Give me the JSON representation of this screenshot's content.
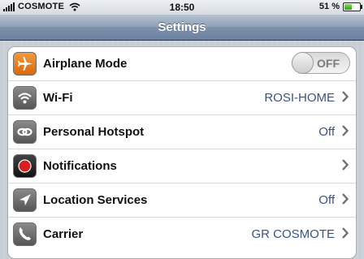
{
  "status_bar": {
    "carrier": "COSMOTE",
    "time": "18:50",
    "battery_percent": "51 %",
    "battery_level": 0.51,
    "icons": [
      "signal-bars-icon",
      "wifi-icon",
      "battery-icon"
    ]
  },
  "nav": {
    "title": "Settings"
  },
  "settings": {
    "airplane": {
      "label": "Airplane Mode",
      "toggle": "OFF",
      "icon": "airplane-icon",
      "icon_color": "#e87d1e"
    },
    "wifi": {
      "label": "Wi-Fi",
      "value": "ROSI-HOME",
      "icon": "wifi-icon",
      "icon_color": "#6d6d6d"
    },
    "hotspot": {
      "label": "Personal Hotspot",
      "value": "Off",
      "icon": "hotspot-link-icon",
      "icon_color": "#6d6d6d"
    },
    "notifications": {
      "label": "Notifications",
      "value": "",
      "icon": "notifications-icon",
      "icon_color": "#d42020"
    },
    "location": {
      "label": "Location Services",
      "value": "Off",
      "icon": "location-arrow-icon",
      "icon_color": "#6d6d6d"
    },
    "carrier": {
      "label": "Carrier",
      "value": "GR COSMOTE",
      "icon": "phone-icon",
      "icon_color": "#6d6d6d"
    }
  },
  "colors": {
    "value_text": "#385487",
    "nav_bar": "#7c8faa",
    "background": "#c5ccd4"
  }
}
